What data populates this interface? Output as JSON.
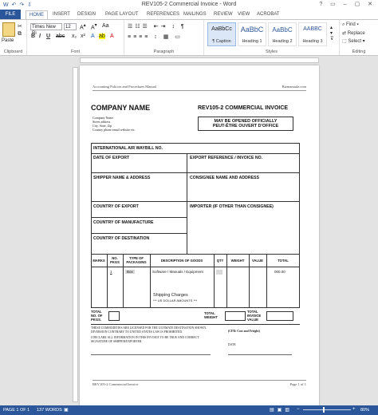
{
  "titlebar": {
    "title": "REV105-2 Commercial Invoice - Word",
    "qat": "W ↶ ↷ ⇩",
    "window_controls": "? ▭ – ▢ ✕"
  },
  "tabs": {
    "file": "FILE",
    "home": "HOME",
    "insert": "INSERT",
    "design": "DESIGN",
    "page_layout": "PAGE LAYOUT",
    "references": "REFERENCES",
    "mailings": "MAILINGS",
    "review": "REVIEW",
    "view": "VIEW",
    "acrobat": "ACROBAT"
  },
  "ribbon": {
    "paste": "Paste",
    "font_name": "Times New Ri",
    "font_size": "12",
    "bold": "B",
    "italic": "I",
    "underline": "U",
    "groups": {
      "clipboard": "Clipboard",
      "font": "Font",
      "paragraph": "Paragraph",
      "styles": "Styles",
      "editing": "Editing"
    },
    "styles": [
      {
        "sample": "AaBbCc",
        "name": "¶ Caption"
      },
      {
        "sample": "AaBbC",
        "name": "Heading 1"
      },
      {
        "sample": "AaBbC",
        "name": "Heading 2"
      },
      {
        "sample": "AABBC",
        "name": "Heading 3"
      }
    ],
    "find": "Find ▾",
    "replace": "Replace",
    "select": "Select ▾"
  },
  "doc": {
    "header_left": "Accounting Policies and Procedures Manual",
    "header_right": "Bizmanualz.com",
    "company": "COMPANY NAME",
    "form_title": "REV105-2 COMMERCIAL INVOICE",
    "addr": [
      "Company Name",
      "Street address",
      "City, State, Zip",
      "Country phone email website etc."
    ],
    "may_open_1": "MAY BE OPENED OFFICIALLY",
    "may_open_2": "PEUT-ÊTRE OUVERT D'OFFICE",
    "awb": "INTERNATIONAL AIR WAYBILL NO.",
    "date_export": "DATE OF EXPORT",
    "export_ref": "EXPORT REFERENCE / INVOICE NO.",
    "shipper": "SHIPPER NAME & ADDRESS",
    "consignee": "CONSIGNEE NAME AND ADDRESS",
    "country_export": "COUNTRY OF EXPORT",
    "importer": "IMPORTER (IF OTHER THAN CONSIGNEE)",
    "country_mfr": "COUNTRY OF MANUFACTURE",
    "country_dest": "COUNTRY OF DESTINATION",
    "cols": [
      "MARKS",
      "NO. PKGS",
      "TYPE OF PACKAGING",
      "DESCRIPTION OF GOODS",
      "QTY",
      "WEIGHT",
      "VALUE",
      "TOTAL"
    ],
    "row_pkgs": "1",
    "row_pack": "Box",
    "row_desc": "Software / Manuals / Equipment",
    "row_total": "000.00",
    "ship_charges": "Shipping Charges",
    "usd": "*** US DOLLAR AMOUNTS ***",
    "total_pkgs": "TOTAL NO. OF PKGS.",
    "total_weight": "TOTAL WEIGHT",
    "total_value": "TOTAL INVOICE VALUE",
    "legal1": "THESE COMMODITIES ARE LICENSED FOR THE ULTIMATE DESTINATION SHOWN.",
    "legal2": "DIVERSION CONTRARY TO UNITED STATES LAW IS PROHIBITED.",
    "cfr": "(CFR: Cost and Freight)",
    "legal3": "I DECLARE ALL INFORMATION IN THIS INVOICE TO BE TRUE AND CORRECT.",
    "legal4": "SIGNATURE OF SHIPPER/EXPORTER",
    "date": "DATE",
    "footer_left": "REV105-2 Commercial Invoice",
    "footer_right": "Page 1 of 1"
  },
  "status": {
    "page": "PAGE 1 OF 1",
    "words": "137 WORDS",
    "zoom": "80%"
  }
}
